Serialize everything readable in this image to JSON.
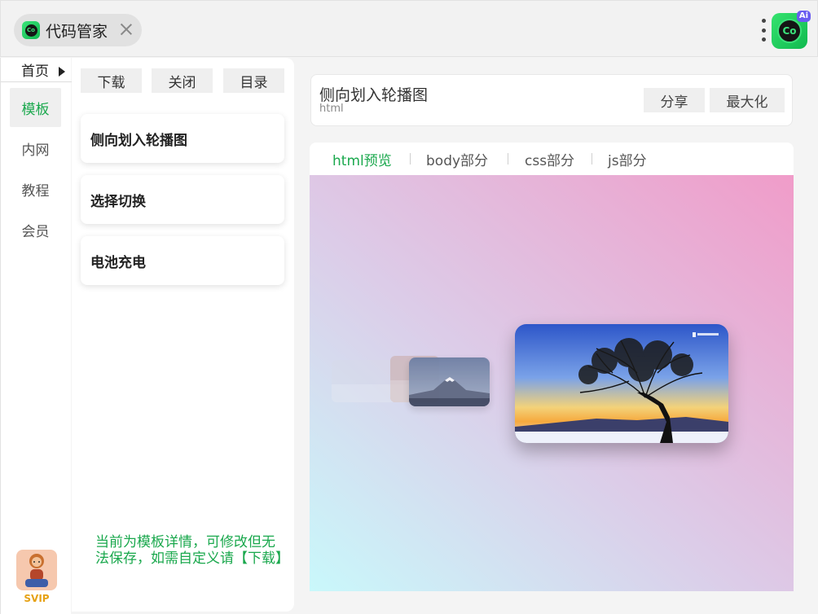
{
  "app": {
    "tab_title": "代码管家",
    "logo_text": "Co",
    "ai_logo_text": "Co",
    "ai_badge": "Ai"
  },
  "nav": {
    "home": "首页",
    "items": [
      {
        "label": "模板",
        "active": true
      },
      {
        "label": "内网",
        "active": false
      },
      {
        "label": "教程",
        "active": false
      },
      {
        "label": "会员",
        "active": false
      }
    ],
    "svip_label": "SVIP"
  },
  "panel": {
    "buttons": [
      "下载",
      "关闭",
      "目录"
    ],
    "templates": [
      "侧向划入轮播图",
      "选择切换",
      "电池充电"
    ],
    "notice": "当前为模板详情，可修改但无法保存，如需自定义请【下载】"
  },
  "detail": {
    "title": "侧向划入轮播图",
    "subtitle": "html",
    "share_label": "分享",
    "maximize_label": "最大化",
    "tabs": [
      {
        "label": "html预览",
        "active": true
      },
      {
        "label": "body部分",
        "active": false
      },
      {
        "label": "css部分",
        "active": false
      },
      {
        "label": "js部分",
        "active": false
      }
    ]
  },
  "colors": {
    "accent_green": "#1aa84d",
    "svip_gold": "#e6a114"
  }
}
